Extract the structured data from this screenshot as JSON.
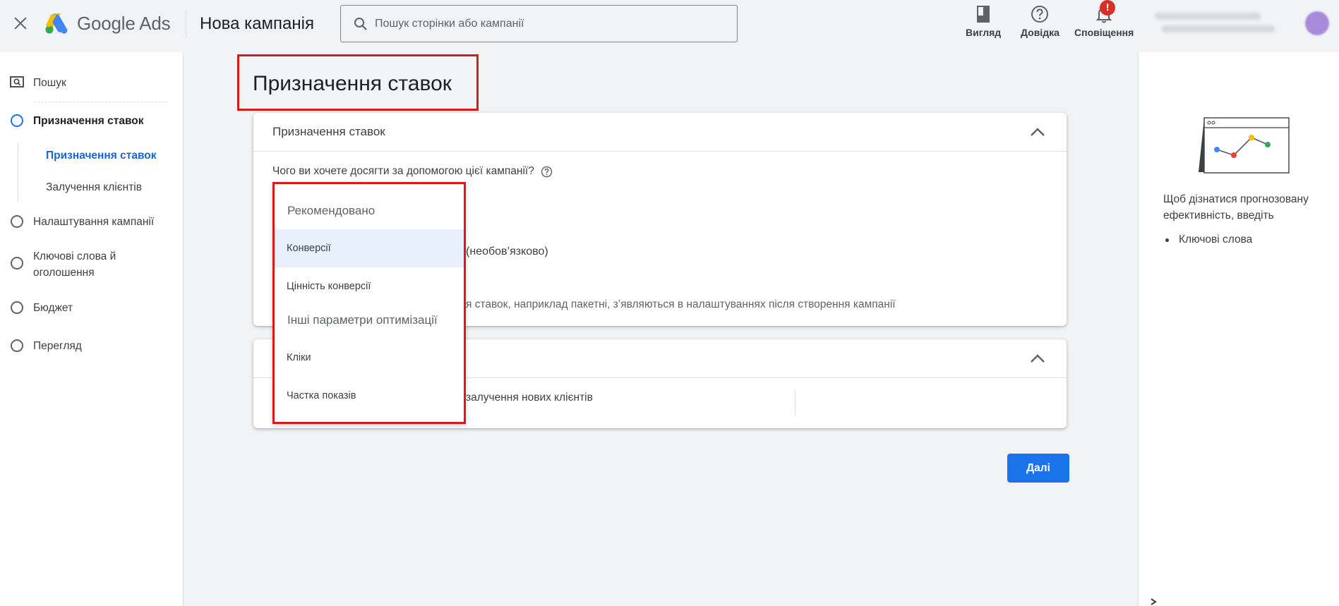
{
  "header": {
    "brand_google": "Google",
    "brand_ads": "Ads",
    "page_name": "Нова кампанія",
    "search_placeholder": "Пошук сторінки або кампанії",
    "view_label": "Вигляд",
    "help_label": "Довідка",
    "notifications_label": "Сповіщення",
    "notifications_badge": "!"
  },
  "sidebar": {
    "items": [
      {
        "label": "Пошук"
      },
      {
        "label": "Призначення ставок"
      },
      {
        "label": "Призначення ставок"
      },
      {
        "label": "Залучення клієнтів"
      },
      {
        "label": "Налаштування кампанії"
      },
      {
        "label": "Ключові слова й оголошення"
      },
      {
        "label": "Бюджет"
      },
      {
        "label": "Перегляд"
      }
    ]
  },
  "main": {
    "title": "Призначення ставок",
    "card1": {
      "title": "Призначення ставок",
      "question": "Чого ви хочете досягти за допомогою цієї кампанії?",
      "partial_optional": "(необов’язково)",
      "partial_note": "я ставок, наприклад пакетні, з’являються в налаштуваннях після створення кампанії"
    },
    "card2": {
      "partial_text": "залучення нових клієнтів"
    },
    "dropdown": {
      "group_recommended": "Рекомендовано",
      "option_conversions": "Конверсії",
      "option_conversion_value": "Цінність конверсії",
      "group_other": "Інші параметри оптимізації",
      "option_clicks": "Кліки",
      "option_impression_share": "Частка показів"
    },
    "next_button": "Далі"
  },
  "right_panel": {
    "text": "Щоб дізнатися прогнозовану ефективність, введіть",
    "list_item": "Ключові слова"
  },
  "colors": {
    "accent_blue": "#1a73e8",
    "highlight_red": "#d41c1c",
    "notification_red": "#d93025"
  }
}
